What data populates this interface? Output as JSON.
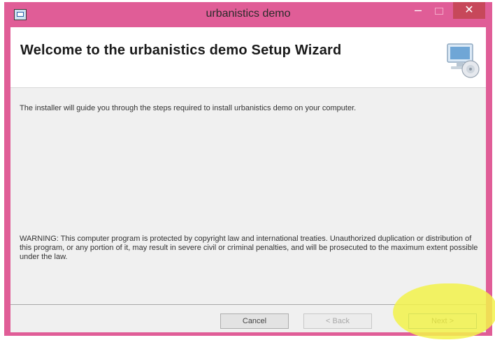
{
  "window": {
    "title": "urbanistics demo",
    "controls": {
      "minimize": "–",
      "close": "✕"
    }
  },
  "banner": {
    "title": "Welcome to the urbanistics demo Setup Wizard",
    "graphic": "computer-cd-icon"
  },
  "body": {
    "intro": "The installer will guide you through the steps required to install urbanistics demo on your computer.",
    "warning": "WARNING: This computer program is protected by copyright law and international treaties. Unauthorized duplication or distribution of this program, or any portion of it, may result in severe civil or criminal penalties, and will be prosecuted to the maximum extent possible under the law."
  },
  "buttons": {
    "cancel": "Cancel",
    "back": "< Back",
    "next": "Next >"
  },
  "colors": {
    "titlebar": "#e05d97",
    "close": "#c7485a",
    "client": "#f0f0f0",
    "highlight": "#f2f24a"
  },
  "icons": {
    "app": "installer-app-icon",
    "close": "close-icon",
    "minimize": "minimize-icon",
    "maximize": "maximize-icon"
  }
}
